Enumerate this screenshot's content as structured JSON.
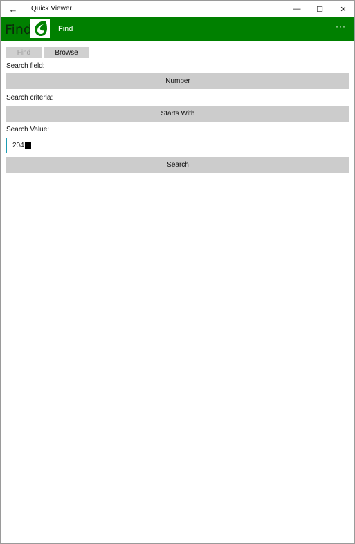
{
  "window": {
    "title": "Quick Viewer",
    "back_icon": "←",
    "minimize_icon": "—",
    "maximize_icon": "☐",
    "close_icon": "✕"
  },
  "header": {
    "big_label": "Find",
    "title": "Find",
    "more_icon": "···",
    "background": "#008000"
  },
  "tabs": {
    "find_label": "Find",
    "browse_label": "Browse"
  },
  "form": {
    "search_field_label": "Search field:",
    "search_field_value": "Number",
    "search_criteria_label": "Search criteria:",
    "search_criteria_value": "Starts With",
    "search_value_label": "Search Value:",
    "search_value": "204",
    "search_button_label": "Search"
  }
}
